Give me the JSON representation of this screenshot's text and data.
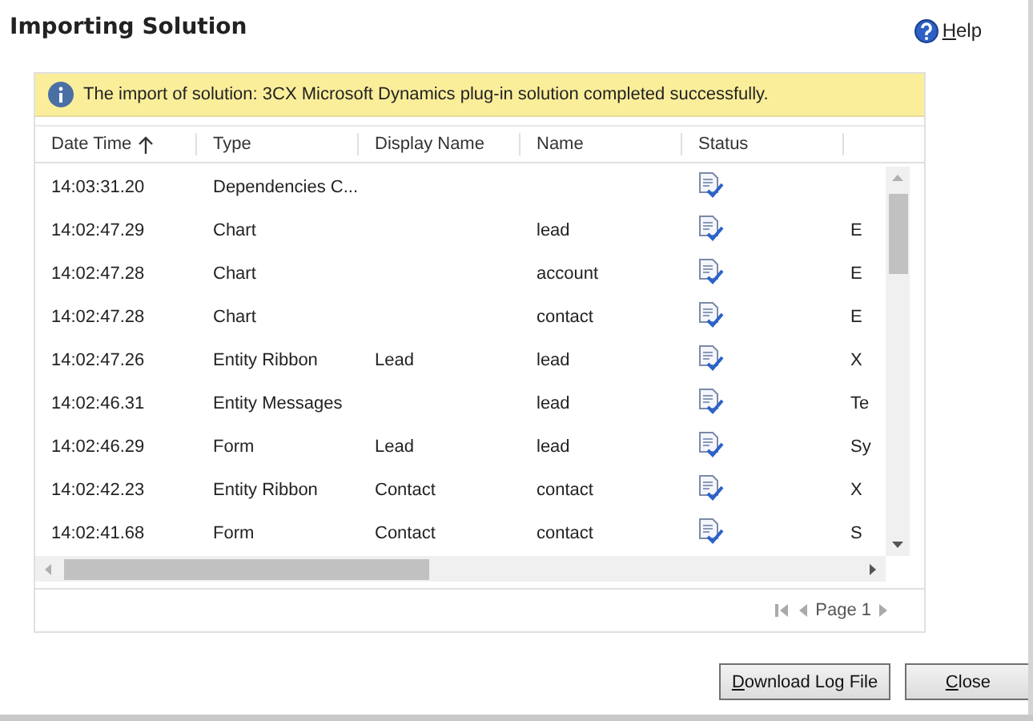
{
  "window": {
    "title": "Importing Solution"
  },
  "help": {
    "label": "Help"
  },
  "notice": {
    "text": "The import of solution: 3CX Microsoft Dynamics plug-in solution completed successfully."
  },
  "table": {
    "columns": [
      {
        "label": "Date Time",
        "sorted": true
      },
      {
        "label": "Type",
        "sorted": false
      },
      {
        "label": "Display Name",
        "sorted": false
      },
      {
        "label": "Name",
        "sorted": false
      },
      {
        "label": "Status",
        "sorted": false
      }
    ],
    "rows": [
      {
        "date_time": "14:03:31.20",
        "type": "Dependencies C...",
        "display_name": "",
        "name": "",
        "column_6": ""
      },
      {
        "date_time": "14:02:47.29",
        "type": "Chart",
        "display_name": "",
        "name": "lead",
        "column_6": "E"
      },
      {
        "date_time": "14:02:47.28",
        "type": "Chart",
        "display_name": "",
        "name": "account",
        "column_6": "E"
      },
      {
        "date_time": "14:02:47.28",
        "type": "Chart",
        "display_name": "",
        "name": "contact",
        "column_6": "E"
      },
      {
        "date_time": "14:02:47.26",
        "type": "Entity Ribbon",
        "display_name": "Lead",
        "name": "lead",
        "column_6": "X"
      },
      {
        "date_time": "14:02:46.31",
        "type": "Entity Messages",
        "display_name": "",
        "name": "lead",
        "column_6": "Te"
      },
      {
        "date_time": "14:02:46.29",
        "type": "Form",
        "display_name": "Lead",
        "name": "lead",
        "column_6": "Sy"
      },
      {
        "date_time": "14:02:42.23",
        "type": "Entity Ribbon",
        "display_name": "Contact",
        "name": "contact",
        "column_6": "X"
      },
      {
        "date_time": "14:02:41.68",
        "type": "Form",
        "display_name": "Contact",
        "name": "contact",
        "column_6": "S"
      }
    ]
  },
  "pager": {
    "label": "Page 1"
  },
  "buttons": [
    {
      "label": "Download Log File"
    },
    {
      "label": "Close"
    }
  ]
}
